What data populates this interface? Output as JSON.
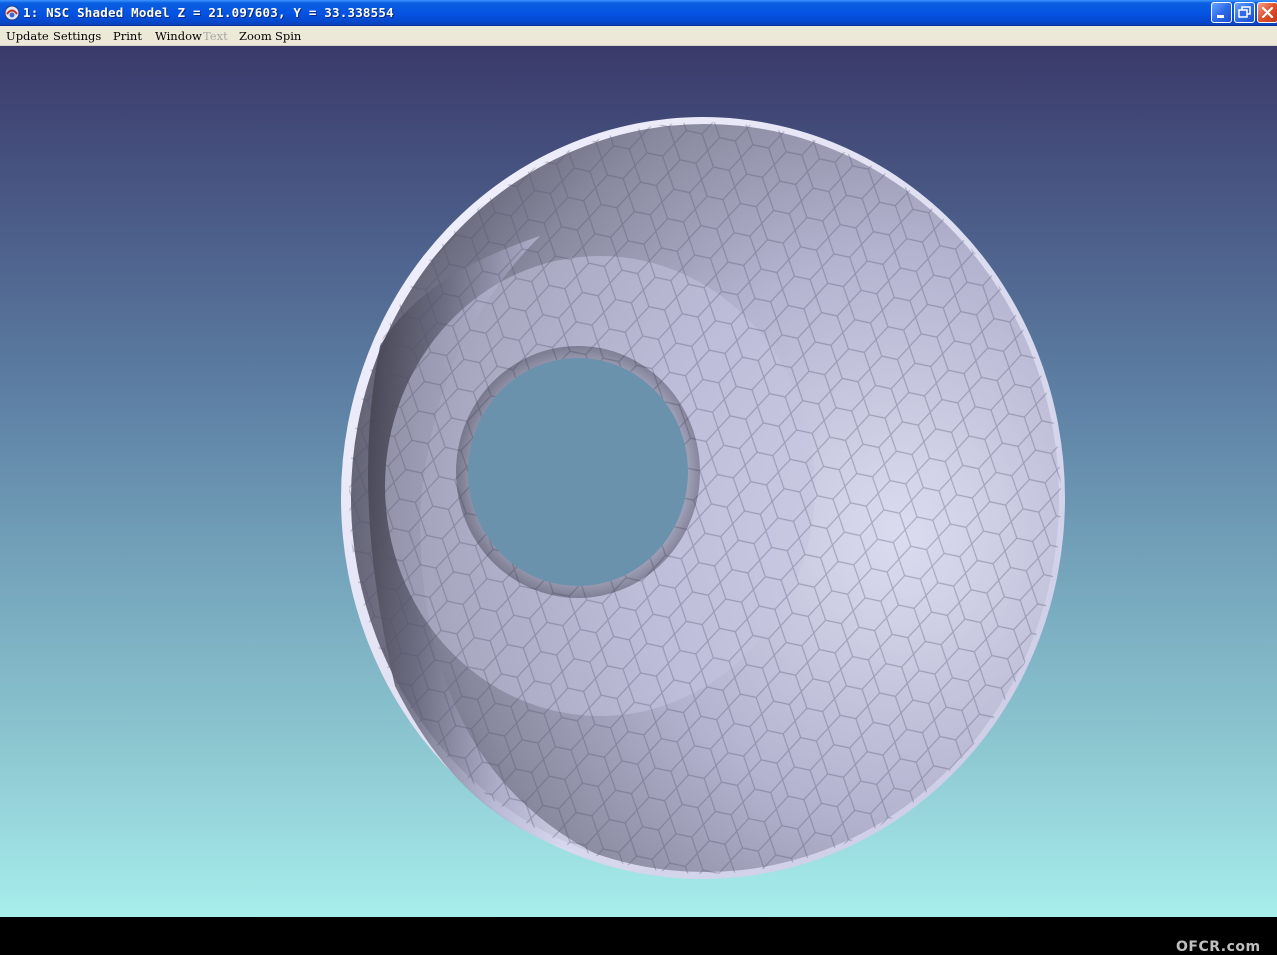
{
  "window": {
    "title": "1: NSC Shaded Model Z = 21.097603, Y = 33.338554",
    "controls": [
      "minimize-icon",
      "restore-icon",
      "close-icon"
    ]
  },
  "menu": {
    "items": [
      {
        "label": "Update",
        "enabled": true
      },
      {
        "label": "Settings",
        "enabled": true
      },
      {
        "label": "Print",
        "enabled": true
      },
      {
        "label": "Window",
        "enabled": true
      },
      {
        "label": "Text",
        "enabled": false
      },
      {
        "label": "Zoom",
        "enabled": true
      },
      {
        "label": "Spin",
        "enabled": true
      }
    ]
  },
  "viewport": {
    "background_top": "#3a3a6a",
    "background_bottom": "#a7eeec",
    "model_color": "#c8c8e4",
    "watermark": "OFCR.com"
  }
}
